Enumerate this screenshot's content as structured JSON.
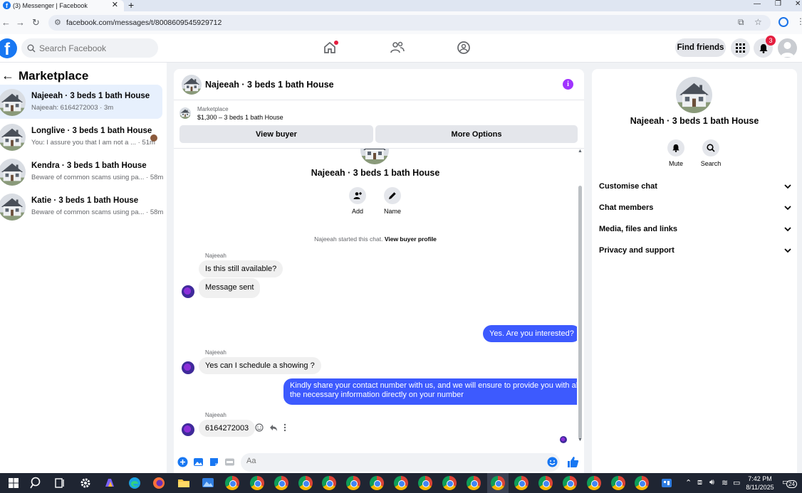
{
  "browser": {
    "tab_title": "(3) Messenger | Facebook",
    "url": "facebook.com/messages/t/8008609545929712",
    "new_tab": "+",
    "tab_close": "✕"
  },
  "topbar": {
    "search_placeholder": "Search Facebook",
    "find_friends": "Find friends",
    "notifications_count": "3"
  },
  "sidebar": {
    "title": "Marketplace",
    "conversations": [
      {
        "name": "Najeeah · 3 beds 1 bath House",
        "preview": "Najeeah: 6164272003 · 3m",
        "active": true
      },
      {
        "name": "Longlive · 3 beds 1 bath House",
        "preview": "You: I assure you that I am not a ... · 51m",
        "active": false
      },
      {
        "name": "Kendra · 3 beds 1 bath House",
        "preview": "Beware of common scams using pa... · 58m",
        "active": false
      },
      {
        "name": "Katie · 3 beds 1 bath House",
        "preview": "Beware of common scams using pa... · 58m",
        "active": false
      }
    ]
  },
  "chat": {
    "header_name": "Najeeah · 3 beds 1 bath House",
    "info_icon": "i",
    "marketplace_label": "Marketplace",
    "listing": "$1,300 – 3 beds 1 bath House",
    "view_buyer": "View buyer",
    "more_options": "More Options",
    "intro_name": "Najeeah · 3 beds 1 bath House",
    "intro_add": "Add",
    "intro_name_btn": "Name",
    "started_text": "Najeeah started this chat.",
    "view_buyer_profile": "View buyer profile",
    "messages": [
      {
        "sender": "Najeeah",
        "text": "Is this still available?"
      },
      {
        "text": "Message sent"
      },
      {
        "text": "Yes. Are you interested?"
      },
      {
        "sender": "Najeeah",
        "text": "Yes can I schedule a showing ?"
      },
      {
        "text_line1": "Kindly share your contact number with us, and we will ensure to provide you with all",
        "text_line2": "the necessary information directly on your number"
      },
      {
        "sender": "Najeeah",
        "text": "6164272003"
      }
    ],
    "composer_placeholder": "Aa"
  },
  "details": {
    "name": "Najeeah · 3 beds 1 bath House",
    "mute": "Mute",
    "search": "Search",
    "sections": [
      "Customise chat",
      "Chat members",
      "Media, files and links",
      "Privacy and support"
    ]
  },
  "taskbar": {
    "time": "7:42 PM",
    "date": "8/11/2025",
    "notif_count": "24"
  },
  "colors": {
    "fb_blue": "#1877f2",
    "outgoing_bubble": "#3d5afe",
    "info_purple": "#a033ff",
    "active_conv": "#e7f0fd"
  }
}
